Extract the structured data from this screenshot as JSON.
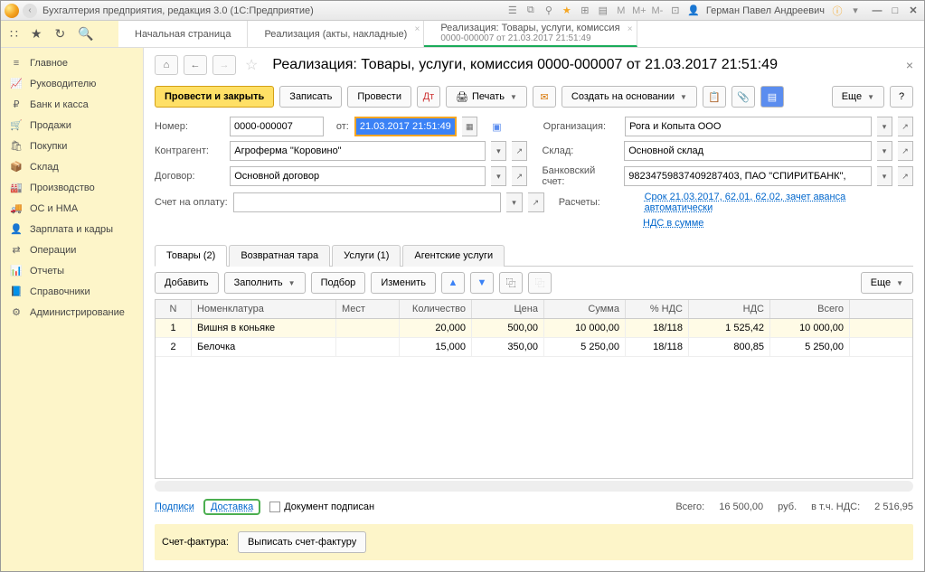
{
  "titlebar": {
    "app_title": "Бухгалтерия предприятия, редакция 3.0 (1С:Предприятие)",
    "user": "Герман Павел Андреевич"
  },
  "tabs": {
    "start": "Начальная страница",
    "t1": "Реализация (акты, накладные)",
    "t2_line1": "Реализация: Товары, услуги, комиссия",
    "t2_line2": "0000-000007 от 21.03.2017 21:51:49"
  },
  "sidebar": [
    {
      "ic": "≡",
      "label": "Главное"
    },
    {
      "ic": "📈",
      "label": "Руководителю"
    },
    {
      "ic": "₽",
      "label": "Банк и касса"
    },
    {
      "ic": "🛒",
      "label": "Продажи"
    },
    {
      "ic": "🛍",
      "label": "Покупки"
    },
    {
      "ic": "📦",
      "label": "Склад"
    },
    {
      "ic": "🏭",
      "label": "Производство"
    },
    {
      "ic": "🚚",
      "label": "ОС и НМА"
    },
    {
      "ic": "👤",
      "label": "Зарплата и кадры"
    },
    {
      "ic": "⇄",
      "label": "Операции"
    },
    {
      "ic": "📊",
      "label": "Отчеты"
    },
    {
      "ic": "📘",
      "label": "Справочники"
    },
    {
      "ic": "⚙",
      "label": "Администрирование"
    }
  ],
  "header": {
    "title": "Реализация: Товары, услуги, комиссия 0000-000007 от 21.03.2017 21:51:49"
  },
  "buttons": {
    "post_close": "Провести и закрыть",
    "write": "Записать",
    "post": "Провести",
    "print": "Печать",
    "create_based": "Создать на основании",
    "more": "Еще"
  },
  "form": {
    "number_lbl": "Номер:",
    "number": "0000-000007",
    "ot_lbl": "от:",
    "date": "21.03.2017 21:51:49",
    "org_lbl": "Организация:",
    "org": "Рога и Копыта ООО",
    "contr_lbl": "Контрагент:",
    "contr": "Агроферма \"Коровино\"",
    "sklad_lbl": "Склад:",
    "sklad": "Основной склад",
    "dog_lbl": "Договор:",
    "dog": "Основной договор",
    "bank_lbl": "Банковский счет:",
    "bank": "98234759837409287403, ПАО \"СПИРИТБАНК\",",
    "pay_lbl": "Счет на оплату:",
    "pay": "",
    "calc_lbl": "Расчеты:",
    "calc_link": "Срок 21.03.2017, 62.01, 62.02, зачет аванса автоматически",
    "nds_link": "НДС в сумме"
  },
  "dtabs": {
    "goods": "Товары (2)",
    "tara": "Возвратная тара",
    "services": "Услуги (1)",
    "agent": "Агентские услуги"
  },
  "tools": {
    "add": "Добавить",
    "fill": "Заполнить",
    "pick": "Подбор",
    "change": "Изменить",
    "more": "Еще"
  },
  "grid": {
    "head": {
      "n": "N",
      "nom": "Номенклатура",
      "mest": "Мест",
      "qty": "Количество",
      "price": "Цена",
      "sum": "Сумма",
      "nds": "% НДС",
      "ndsv": "НДС",
      "tot": "Всего"
    },
    "rows": [
      {
        "n": "1",
        "nom": "Вишня в коньяке",
        "mest": "",
        "qty": "20,000",
        "price": "500,00",
        "sum": "10 000,00",
        "nds": "18/118",
        "ndsv": "1 525,42",
        "tot": "10 000,00"
      },
      {
        "n": "2",
        "nom": "Белочка",
        "mest": "",
        "qty": "15,000",
        "price": "350,00",
        "sum": "5 250,00",
        "nds": "18/118",
        "ndsv": "800,85",
        "tot": "5 250,00"
      }
    ]
  },
  "footer": {
    "signatures": "Подписи",
    "delivery": "Доставка",
    "signed": "Документ подписан",
    "total_lbl": "Всего:",
    "total": "16 500,00",
    "cur": "руб.",
    "nds_lbl": "в т.ч. НДС:",
    "nds": "2 516,95",
    "sf_lbl": "Счет-фактура:",
    "sf_btn": "Выписать счет-фактуру"
  }
}
